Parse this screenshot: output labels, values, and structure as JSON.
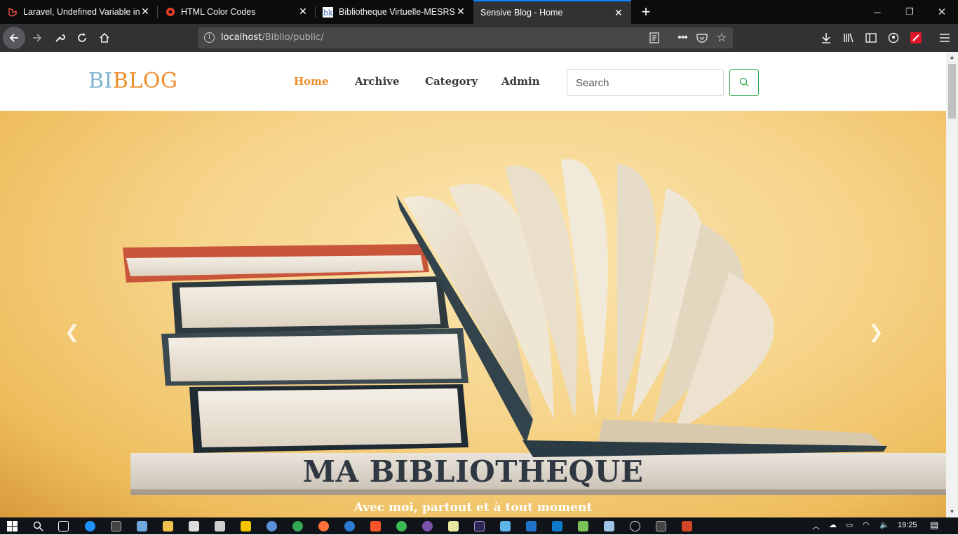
{
  "browser": {
    "tabs": [
      {
        "title": "Laravel, Undefined Variable in V",
        "favicon": "laravel-icon",
        "active": false
      },
      {
        "title": "HTML Color Codes",
        "favicon": "color-codes-icon",
        "active": false
      },
      {
        "title": "Bibliotheque Virtuelle-MESRS",
        "favicon": "bibliotheque-icon",
        "active": false
      },
      {
        "title": "Sensive Blog - Home",
        "favicon": "none",
        "active": true
      }
    ],
    "url_host": "localhost",
    "url_path": "/Biblio/public/"
  },
  "site": {
    "logo_part1": "BI",
    "logo_part2": "BLOG",
    "menu": [
      "Home",
      "Archive",
      "Category",
      "Admin"
    ],
    "active_menu": "Home",
    "search_placeholder": "Search",
    "colors": {
      "accent": "#ee8e2c",
      "logo_blue": "#7fb3cf",
      "search_border": "#28a745"
    }
  },
  "hero": {
    "title": "MA BIBLIOTHEQUE",
    "subtitle": "Avec moi, partout et à tout moment"
  },
  "taskbar": {
    "time": "19:25"
  }
}
